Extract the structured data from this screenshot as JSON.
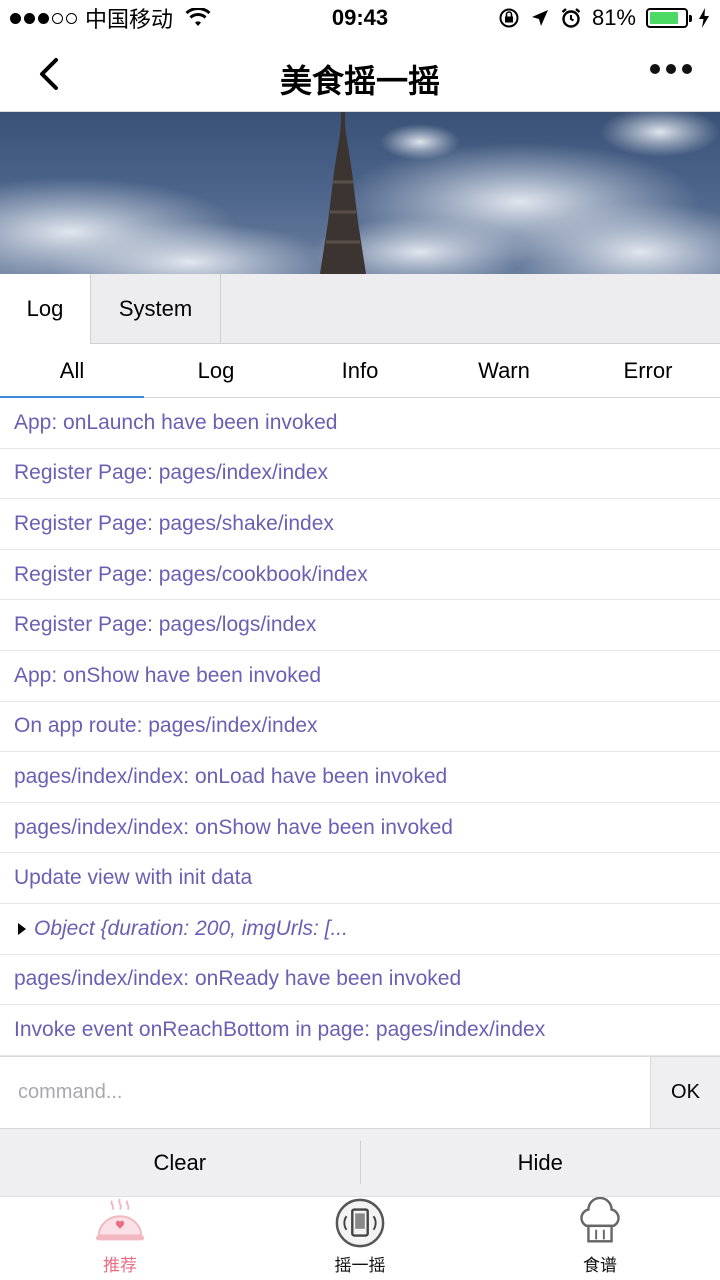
{
  "status": {
    "carrier": "中国移动",
    "time": "09:43",
    "battery_pct": "81%",
    "battery_level": 0.81
  },
  "nav": {
    "title": "美食摇一摇"
  },
  "tabs": [
    {
      "label": "Log"
    },
    {
      "label": "System"
    }
  ],
  "filters": [
    {
      "label": "All"
    },
    {
      "label": "Log"
    },
    {
      "label": "Info"
    },
    {
      "label": "Warn"
    },
    {
      "label": "Error"
    }
  ],
  "logs": [
    "App: onLaunch have been invoked",
    "Register Page: pages/index/index",
    "Register Page: pages/shake/index",
    "Register Page: pages/cookbook/index",
    "Register Page: pages/logs/index",
    "App: onShow have been invoked",
    "On app route: pages/index/index",
    "pages/index/index: onLoad have been invoked",
    "pages/index/index: onShow have been invoked",
    "Update view with init data",
    "Object {duration: 200, imgUrls: [...",
    "pages/index/index: onReady have been invoked",
    "Invoke event onReachBottom in page: pages/index/index"
  ],
  "command": {
    "placeholder": "command...",
    "ok_label": "OK"
  },
  "actions": {
    "clear_label": "Clear",
    "hide_label": "Hide"
  },
  "tabbar": {
    "items": [
      {
        "label": "推荐",
        "icon": "cloche-icon"
      },
      {
        "label": "摇一摇",
        "icon": "shake-phone-icon"
      },
      {
        "label": "食谱",
        "icon": "chef-hat-icon"
      }
    ],
    "accent": "#e96e84"
  }
}
